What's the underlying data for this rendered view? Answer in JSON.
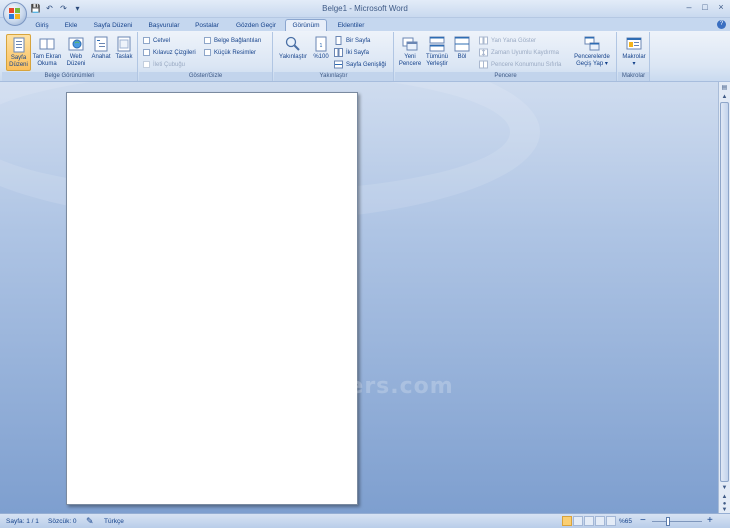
{
  "window": {
    "title": "Belge1 - Microsoft Word",
    "minimize": "–",
    "maximize": "□",
    "close": "×"
  },
  "qat": {
    "save": "💾",
    "undo": "↶",
    "redo": "↷",
    "customize": "▾"
  },
  "tabs": [
    "Giriş",
    "Ekle",
    "Sayfa Düzeni",
    "Başvurular",
    "Postalar",
    "Gözden Geçir",
    "Görünüm",
    "Eklentiler"
  ],
  "help": "?",
  "ribbon": {
    "belge_gorunumleri": {
      "label": "Belge Görünümleri",
      "buttons": [
        {
          "l1": "Sayfa",
          "l2": "Düzeni"
        },
        {
          "l1": "Tam Ekran",
          "l2": "Okuma"
        },
        {
          "l1": "Web",
          "l2": "Düzeni"
        },
        {
          "l1": "Anahat",
          "l2": ""
        },
        {
          "l1": "Taslak",
          "l2": ""
        }
      ]
    },
    "goster_gizle": {
      "label": "Göster/Gizle",
      "cetvel": "Cetvel",
      "kilavuz": "Kılavuz Çizgileri",
      "ileti": "İleti Çubuğu",
      "belge_bag": "Belge Bağlantıları",
      "kucuk": "Küçük Resimler"
    },
    "yakinlastir": {
      "label": "Yakınlaştır",
      "zoom_btn": "Yakınlaştır",
      "percent_btn": "%100",
      "bir_sayfa": "Bir Sayfa",
      "iki_sayfa": "İki Sayfa",
      "sayfa_genisligi": "Sayfa Genişliği"
    },
    "pencere": {
      "label": "Pencere",
      "yeni": {
        "l1": "Yeni",
        "l2": "Pencere"
      },
      "tumunu": {
        "l1": "Tümünü",
        "l2": "Yerleştir"
      },
      "bol": "Böl",
      "yan_yana": "Yan Yana Göster",
      "zaman": "Zaman Uyumlu Kaydırma",
      "konum": "Pencere Konumunu Sıfırla",
      "gecis": {
        "l1": "Pencerelerde",
        "l2": "Geçiş Yap ▾"
      }
    },
    "makrolar": {
      "label": "Makrolar",
      "btn": "Makrolar",
      "arrow": "▾"
    }
  },
  "watermark": "www.dijitaders.com",
  "status": {
    "page": "Sayfa: 1 / 1",
    "words": "Sözcük: 0",
    "lang": "Türkçe",
    "zoom": "%65",
    "zoom_minus": "−",
    "zoom_plus": "+",
    "zoom_level_percent": 65
  },
  "scrollbar": {
    "up": "▲",
    "down": "▼",
    "prev": "▲",
    "browse": "●",
    "next": "▼"
  },
  "colors": {
    "accent": "#15428b",
    "active_tab_bg": "#e7eef9",
    "active_button": "#fbc05d"
  }
}
